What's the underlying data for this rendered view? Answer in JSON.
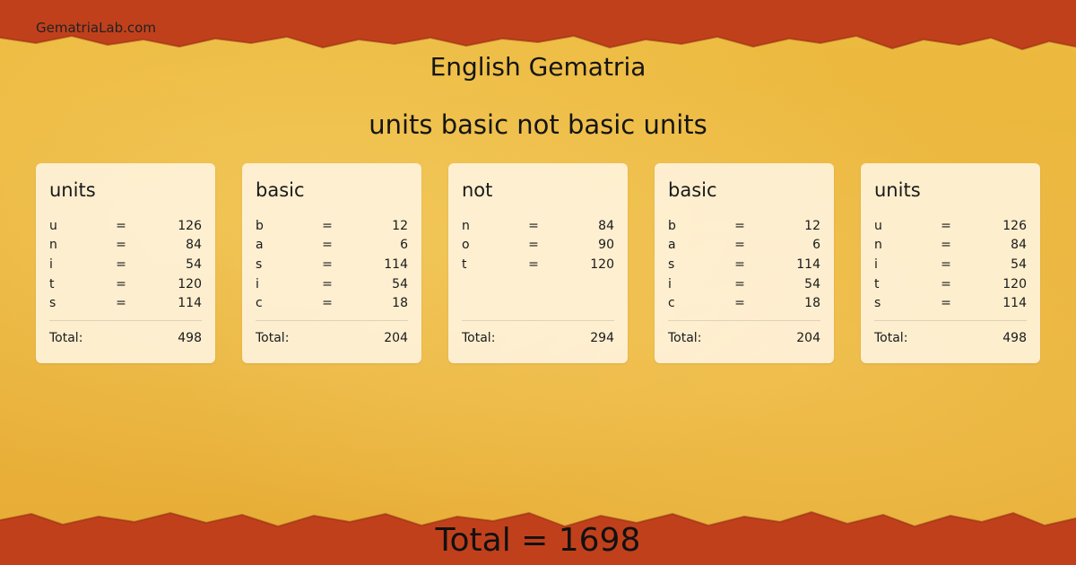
{
  "site": {
    "name": "GematriaLab.com"
  },
  "header": {
    "calc_title": "English Gematria",
    "phrase": "units basic not basic units"
  },
  "theme": {
    "background": "#e9b43c",
    "border": "#c1401c",
    "card": "#fff5e1"
  },
  "labels": {
    "equals": "=",
    "total": "Total:"
  },
  "cards": [
    {
      "word": "units",
      "letters": [
        {
          "letter": "u",
          "value": "126"
        },
        {
          "letter": "n",
          "value": "84"
        },
        {
          "letter": "i",
          "value": "54"
        },
        {
          "letter": "t",
          "value": "120"
        },
        {
          "letter": "s",
          "value": "114"
        }
      ],
      "total": "498"
    },
    {
      "word": "basic",
      "letters": [
        {
          "letter": "b",
          "value": "12"
        },
        {
          "letter": "a",
          "value": "6"
        },
        {
          "letter": "s",
          "value": "114"
        },
        {
          "letter": "i",
          "value": "54"
        },
        {
          "letter": "c",
          "value": "18"
        }
      ],
      "total": "204"
    },
    {
      "word": "not",
      "letters": [
        {
          "letter": "n",
          "value": "84"
        },
        {
          "letter": "o",
          "value": "90"
        },
        {
          "letter": "t",
          "value": "120"
        }
      ],
      "total": "294"
    },
    {
      "word": "basic",
      "letters": [
        {
          "letter": "b",
          "value": "12"
        },
        {
          "letter": "a",
          "value": "6"
        },
        {
          "letter": "s",
          "value": "114"
        },
        {
          "letter": "i",
          "value": "54"
        },
        {
          "letter": "c",
          "value": "18"
        }
      ],
      "total": "204"
    },
    {
      "word": "units",
      "letters": [
        {
          "letter": "u",
          "value": "126"
        },
        {
          "letter": "n",
          "value": "84"
        },
        {
          "letter": "i",
          "value": "54"
        },
        {
          "letter": "t",
          "value": "120"
        },
        {
          "letter": "s",
          "value": "114"
        }
      ],
      "total": "498"
    }
  ],
  "grand_total": {
    "text": "Total = 1698"
  }
}
